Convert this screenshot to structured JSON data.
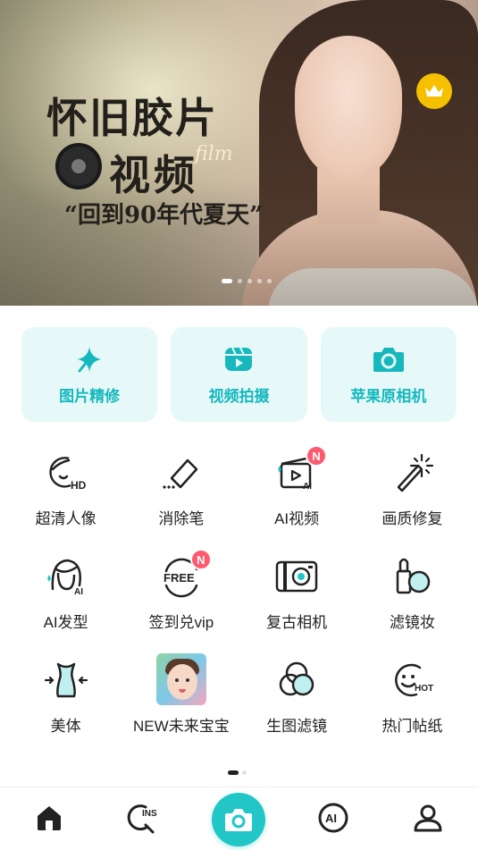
{
  "banner": {
    "title_line1": "怀旧胶片",
    "title_line2": "视频",
    "script_text": "film",
    "subtitle": "“回到90年代夏天”",
    "vip_icon": "crown-icon",
    "carousel_pages": 5,
    "carousel_active": 1
  },
  "cards": [
    {
      "label": "图片精修",
      "icon": "sparkle-star-icon"
    },
    {
      "label": "视频拍摄",
      "icon": "video-record-icon"
    },
    {
      "label": "苹果原相机",
      "icon": "camera-icon"
    }
  ],
  "grid": [
    {
      "label": "超清人像",
      "icon": "hd-portrait-icon",
      "icon_text": "HD"
    },
    {
      "label": "消除笔",
      "icon": "eraser-icon"
    },
    {
      "label": "AI视频",
      "icon": "ai-video-icon",
      "badge": "N",
      "icon_text": "AI"
    },
    {
      "label": "画质修复",
      "icon": "magic-wand-icon"
    },
    {
      "label": "AI发型",
      "icon": "ai-hairstyle-icon",
      "icon_text": "AI"
    },
    {
      "label": "签到兑vip",
      "icon": "free-checkin-icon",
      "badge": "N",
      "icon_text": "FREE"
    },
    {
      "label": "复古相机",
      "icon": "retro-camera-icon"
    },
    {
      "label": "滤镜妆",
      "icon": "lipstick-makeup-icon"
    },
    {
      "label": "美体",
      "icon": "body-shape-icon"
    },
    {
      "label": "NEW未来宝宝",
      "icon": "baby-photo-icon"
    },
    {
      "label": "生图滤镜",
      "icon": "color-filter-icon"
    },
    {
      "label": "热门帖纸",
      "icon": "hot-sticker-icon",
      "icon_text": "HOT"
    }
  ],
  "grid_pages": 2,
  "grid_page_active": 1,
  "tabbar": {
    "items": [
      {
        "name": "home",
        "icon": "home-icon"
      },
      {
        "name": "ins",
        "icon": "ins-search-icon",
        "icon_text": "INS"
      },
      {
        "name": "camera",
        "icon": "camera-icon"
      },
      {
        "name": "ai",
        "icon": "ai-icon",
        "icon_text": "AI"
      },
      {
        "name": "profile",
        "icon": "user-icon"
      }
    ],
    "active": "home"
  },
  "colors": {
    "accent": "#22c6c6",
    "card_bg": "#e6f9f8",
    "card_text": "#16b8be",
    "badge": "#ff5a6e",
    "crown": "#f5c000"
  }
}
